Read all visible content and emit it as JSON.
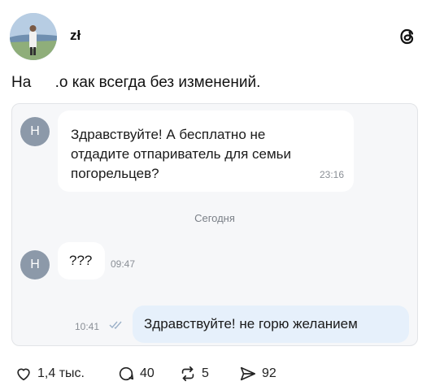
{
  "post": {
    "username": "zł",
    "text_before": "На ",
    "text_after": ".о как всегда без изменений."
  },
  "chat": {
    "avatar_letter": "Н",
    "messages": [
      {
        "text": "Здравствуйте! А бесплатно не отдадите отпариватель для семьи погорельцев?",
        "time": "23:16"
      },
      {
        "text": "???",
        "time": "09:47"
      },
      {
        "text": "Здравствуйте! не горю желанием",
        "time": "10:41"
      }
    ],
    "date_separator": "Сегодня"
  },
  "actions": {
    "likes": "1,4 тыс.",
    "comments": "40",
    "reposts": "5",
    "shares": "92"
  },
  "colors": {
    "outgoing_bubble": "#e6f0fb",
    "incoming_bubble": "#ffffff",
    "chat_background": "#f6f7f9",
    "avatar_gray": "#8c99a9"
  },
  "icons": [
    "threads-logo-icon",
    "heart-icon",
    "comment-icon",
    "repost-icon",
    "share-icon",
    "double-check-icon"
  ]
}
